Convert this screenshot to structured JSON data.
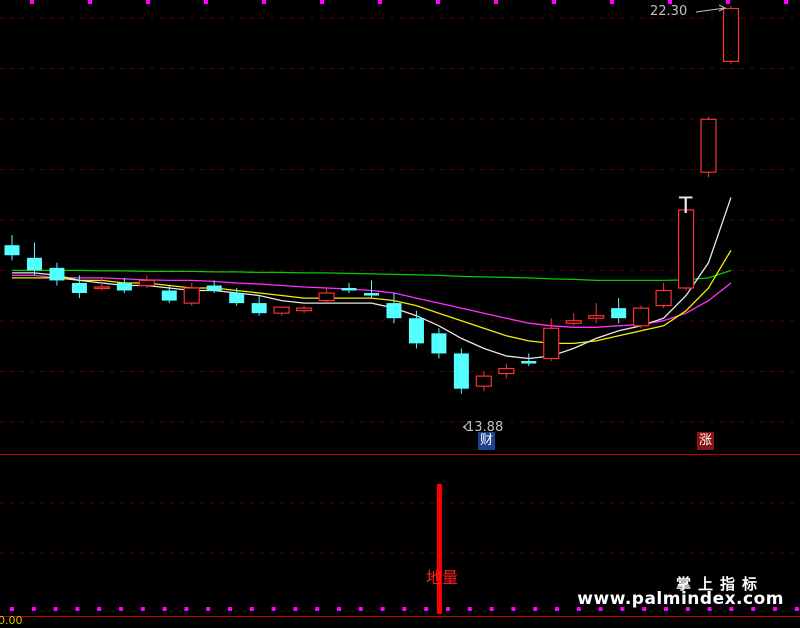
{
  "chart_data": {
    "type": "candlestick",
    "high_label": "22.30",
    "low_label": "13.88",
    "tag_cai": "财",
    "tag_zhang": "涨",
    "label_T": "T",
    "signal_label": "地量",
    "bottom_value": "0.00",
    "colors": {
      "up": "#ff3030",
      "down": "#54ffff",
      "ma_white": "#e8e8e8",
      "ma_yellow": "#f0f000",
      "ma_magenta": "#ff30ff",
      "ma_green": "#00d000",
      "grid": "#5a0000",
      "divider": "#c00000",
      "dots": "#ff00ff",
      "volume_bar": "#ff0000"
    },
    "ohlc": [
      {
        "o": 17.55,
        "h": 17.75,
        "c": 17.35,
        "l": 17.25
      },
      {
        "o": 17.3,
        "h": 17.6,
        "c": 17.05,
        "l": 16.95
      },
      {
        "o": 17.1,
        "h": 17.2,
        "c": 16.85,
        "l": 16.75
      },
      {
        "o": 16.8,
        "h": 16.95,
        "c": 16.6,
        "l": 16.5
      },
      {
        "o": 16.7,
        "h": 16.9,
        "c": 16.72,
        "l": 16.65
      },
      {
        "o": 16.8,
        "h": 16.9,
        "c": 16.65,
        "l": 16.6
      },
      {
        "o": 16.75,
        "h": 16.95,
        "c": 16.85,
        "l": 16.7
      },
      {
        "o": 16.65,
        "h": 16.75,
        "c": 16.45,
        "l": 16.4
      },
      {
        "o": 16.4,
        "h": 16.8,
        "c": 16.7,
        "l": 16.35
      },
      {
        "o": 16.75,
        "h": 16.85,
        "c": 16.65,
        "l": 16.6
      },
      {
        "o": 16.6,
        "h": 16.7,
        "c": 16.4,
        "l": 16.35
      },
      {
        "o": 16.4,
        "h": 16.55,
        "c": 16.2,
        "l": 16.15
      },
      {
        "o": 16.2,
        "h": 16.3,
        "c": 16.32,
        "l": 16.15
      },
      {
        "o": 16.25,
        "h": 16.35,
        "c": 16.3,
        "l": 16.2
      },
      {
        "o": 16.45,
        "h": 16.7,
        "c": 16.6,
        "l": 16.4
      },
      {
        "o": 16.7,
        "h": 16.8,
        "c": 16.65,
        "l": 16.6
      },
      {
        "o": 16.6,
        "h": 16.85,
        "c": 16.55,
        "l": 16.5
      },
      {
        "o": 16.4,
        "h": 16.6,
        "c": 16.1,
        "l": 16.0
      },
      {
        "o": 16.1,
        "h": 16.25,
        "c": 15.6,
        "l": 15.5
      },
      {
        "o": 15.8,
        "h": 15.9,
        "c": 15.4,
        "l": 15.3
      },
      {
        "o": 15.4,
        "h": 15.5,
        "c": 14.7,
        "l": 14.6
      },
      {
        "o": 14.75,
        "h": 15.05,
        "c": 14.95,
        "l": 14.65
      },
      {
        "o": 15.0,
        "h": 15.2,
        "c": 15.1,
        "l": 14.9
      },
      {
        "o": 15.25,
        "h": 15.4,
        "c": 15.2,
        "l": 15.15
      },
      {
        "o": 15.3,
        "h": 16.1,
        "c": 15.9,
        "l": 15.25
      },
      {
        "o": 16.0,
        "h": 16.2,
        "c": 16.05,
        "l": 15.95
      },
      {
        "o": 16.1,
        "h": 16.4,
        "c": 16.15,
        "l": 16.0
      },
      {
        "o": 16.3,
        "h": 16.5,
        "c": 16.1,
        "l": 16.0
      },
      {
        "o": 15.95,
        "h": 16.35,
        "c": 16.3,
        "l": 15.9
      },
      {
        "o": 16.35,
        "h": 16.8,
        "c": 16.65,
        "l": 16.3
      },
      {
        "o": 16.7,
        "h": 18.3,
        "c": 18.25,
        "l": 16.65
      },
      {
        "o": 19.0,
        "h": 20.1,
        "c": 20.05,
        "l": 18.9
      },
      {
        "o": 21.2,
        "h": 22.3,
        "c": 22.25,
        "l": 21.15
      }
    ],
    "ma_white": [
      17.0,
      17.0,
      16.95,
      16.85,
      16.8,
      16.75,
      16.75,
      16.7,
      16.65,
      16.65,
      16.6,
      16.55,
      16.45,
      16.4,
      16.4,
      16.4,
      16.4,
      16.3,
      16.15,
      15.95,
      15.7,
      15.5,
      15.35,
      15.3,
      15.35,
      15.5,
      15.7,
      15.85,
      15.95,
      16.1,
      16.55,
      17.2,
      18.5
    ],
    "ma_yellow": [
      16.9,
      16.9,
      16.9,
      16.85,
      16.85,
      16.8,
      16.8,
      16.75,
      16.7,
      16.7,
      16.65,
      16.6,
      16.55,
      16.5,
      16.5,
      16.5,
      16.5,
      16.45,
      16.35,
      16.2,
      16.05,
      15.9,
      15.75,
      15.65,
      15.6,
      15.6,
      15.65,
      15.75,
      15.85,
      15.95,
      16.25,
      16.7,
      17.45
    ],
    "ma_magenta": [
      16.95,
      16.95,
      16.9,
      16.9,
      16.9,
      16.88,
      16.86,
      16.85,
      16.85,
      16.83,
      16.8,
      16.78,
      16.75,
      16.72,
      16.7,
      16.68,
      16.65,
      16.6,
      16.5,
      16.4,
      16.3,
      16.2,
      16.1,
      16.0,
      15.95,
      15.92,
      15.92,
      15.95,
      15.98,
      16.05,
      16.2,
      16.45,
      16.8
    ],
    "ma_green": [
      17.05,
      17.05,
      17.05,
      17.05,
      17.04,
      17.04,
      17.03,
      17.03,
      17.03,
      17.02,
      17.02,
      17.01,
      17.01,
      17.0,
      17.0,
      16.99,
      16.98,
      16.97,
      16.96,
      16.95,
      16.93,
      16.92,
      16.91,
      16.9,
      16.88,
      16.87,
      16.85,
      16.85,
      16.85,
      16.85,
      16.86,
      16.9,
      17.05
    ],
    "volume": [
      0,
      0,
      0,
      0,
      0,
      0,
      0,
      0,
      0,
      0,
      0,
      0,
      0,
      0,
      0,
      0,
      0,
      0,
      0,
      1,
      0,
      0,
      0,
      0,
      0,
      0,
      0,
      0,
      0,
      0,
      0,
      0,
      0
    ]
  }
}
